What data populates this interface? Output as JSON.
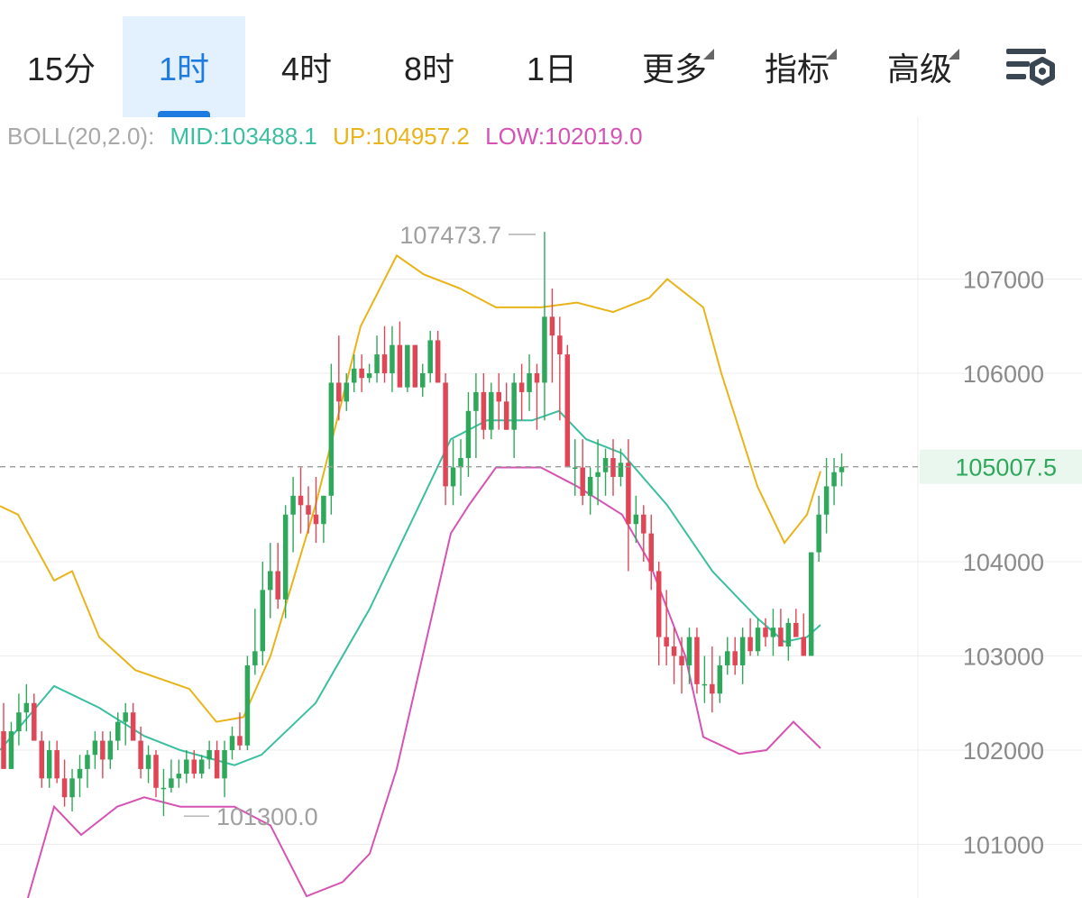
{
  "toolbar": {
    "tabs": [
      {
        "label": "15分",
        "active": false,
        "menu": false
      },
      {
        "label": "1时",
        "active": true,
        "menu": false
      },
      {
        "label": "4时",
        "active": false,
        "menu": false
      },
      {
        "label": "8时",
        "active": false,
        "menu": false
      },
      {
        "label": "1日",
        "active": false,
        "menu": false
      },
      {
        "label": "更多",
        "active": false,
        "menu": true
      },
      {
        "label": "指标",
        "active": false,
        "menu": true
      },
      {
        "label": "高级",
        "active": false,
        "menu": true
      }
    ],
    "settings_icon": "chart-settings-icon"
  },
  "boll": {
    "label": "BOLL(20,2.0):",
    "mid": "MID:103488.1",
    "up": "UP:104957.2",
    "low": "LOW:102019.0",
    "colors": {
      "label": "#a8a8a8",
      "mid": "#3bbfa0",
      "up": "#e8b419",
      "low": "#d653b4"
    }
  },
  "chart_data": {
    "type": "candlestick",
    "y_ticks": [
      "107000",
      "106000",
      "104000",
      "103000",
      "102000",
      "101000"
    ],
    "ylim": [
      100450,
      108300
    ],
    "current_price": "105007.5",
    "high_label": "107473.7",
    "low_label": "101300.0",
    "colors": {
      "up": "#2fa85c",
      "down": "#e04656",
      "mid": "#3bbfa0",
      "upper": "#e8b419",
      "lower": "#d653b4",
      "price": "#2fa85c"
    },
    "candles": [
      [
        102200,
        102500,
        101900,
        101800
      ],
      [
        101800,
        102300,
        101800,
        102200
      ],
      [
        102200,
        102600,
        102050,
        102400
      ],
      [
        102400,
        102700,
        102200,
        102500
      ],
      [
        102500,
        102600,
        102100,
        102100
      ],
      [
        102100,
        102200,
        101600,
        101700
      ],
      [
        101700,
        102100,
        101600,
        102000
      ],
      [
        102000,
        102100,
        101650,
        101700
      ],
      [
        101700,
        101900,
        101400,
        101500
      ],
      [
        101500,
        101800,
        101350,
        101700
      ],
      [
        101700,
        101950,
        101500,
        101800
      ],
      [
        101800,
        102000,
        101600,
        101950
      ],
      [
        101950,
        102200,
        101800,
        102100
      ],
      [
        102100,
        102200,
        101700,
        101900
      ],
      [
        101900,
        102200,
        101800,
        102100
      ],
      [
        102100,
        102400,
        102000,
        102300
      ],
      [
        102300,
        102500,
        102050,
        102400
      ],
      [
        102400,
        102500,
        102100,
        102100
      ],
      [
        102100,
        102250,
        101700,
        101800
      ],
      [
        101800,
        102050,
        101650,
        101950
      ],
      [
        101950,
        102000,
        101500,
        101600
      ],
      [
        101600,
        101800,
        101300,
        101600
      ],
      [
        101600,
        101900,
        101550,
        101700
      ],
      [
        101700,
        101900,
        101600,
        101750
      ],
      [
        101750,
        102000,
        101650,
        101900
      ],
      [
        101900,
        102000,
        101700,
        101750
      ],
      [
        101750,
        101950,
        101700,
        101900
      ],
      [
        101900,
        102100,
        101800,
        102000
      ],
      [
        102000,
        102100,
        101700,
        101700
      ],
      [
        101700,
        102100,
        101500,
        102000
      ],
      [
        102000,
        102250,
        101900,
        102150
      ],
      [
        102150,
        102400,
        102000,
        102050
      ],
      [
        102050,
        103000,
        102000,
        102900
      ],
      [
        102900,
        103500,
        102800,
        103050
      ],
      [
        103050,
        104000,
        102900,
        103700
      ],
      [
        103700,
        104200,
        103400,
        103900
      ],
      [
        103900,
        104200,
        103500,
        103600
      ],
      [
        103600,
        104600,
        103400,
        104500
      ],
      [
        104500,
        104900,
        104100,
        104700
      ],
      [
        104700,
        105000,
        104300,
        104600
      ],
      [
        104600,
        104800,
        104300,
        104500
      ],
      [
        104500,
        104900,
        104200,
        104400
      ],
      [
        104400,
        104700,
        104200,
        104700
      ],
      [
        104700,
        106100,
        104500,
        105900
      ],
      [
        105900,
        106400,
        105500,
        105700
      ],
      [
        105700,
        106000,
        105600,
        105900
      ],
      [
        105900,
        106200,
        105800,
        106050
      ],
      [
        106050,
        106200,
        105800,
        105950
      ],
      [
        105950,
        106100,
        105900,
        106000
      ],
      [
        106000,
        106400,
        105900,
        106200
      ],
      [
        106200,
        106500,
        105900,
        106000
      ],
      [
        106000,
        106500,
        105800,
        106300
      ],
      [
        106300,
        106550,
        105900,
        105850
      ],
      [
        105850,
        106300,
        105800,
        106300
      ],
      [
        106300,
        106300,
        105850,
        105850
      ],
      [
        105850,
        106100,
        105750,
        106000
      ],
      [
        106000,
        106450,
        105900,
        106350
      ],
      [
        106350,
        106450,
        105900,
        105900
      ],
      [
        105900,
        106000,
        104600,
        104800
      ],
      [
        104800,
        105300,
        104600,
        105000
      ],
      [
        105000,
        105300,
        104700,
        105100
      ],
      [
        105100,
        105800,
        104900,
        105600
      ],
      [
        105600,
        106000,
        105100,
        105800
      ],
      [
        105800,
        106000,
        105300,
        105400
      ],
      [
        105400,
        105900,
        105300,
        105800
      ],
      [
        105800,
        106000,
        105400,
        105700
      ],
      [
        105700,
        105900,
        105400,
        105400
      ],
      [
        105400,
        106000,
        105100,
        105900
      ],
      [
        105900,
        106100,
        105500,
        105800
      ],
      [
        105800,
        106200,
        105600,
        106000
      ],
      [
        106000,
        106100,
        105400,
        105900
      ],
      [
        105900,
        107500,
        105500,
        106600
      ],
      [
        106600,
        106900,
        105900,
        106400
      ],
      [
        106400,
        106600,
        105500,
        106200
      ],
      [
        106200,
        106300,
        105000,
        105000
      ],
      [
        105000,
        105300,
        104700,
        105000
      ],
      [
        105000,
        105300,
        104600,
        104700
      ],
      [
        104700,
        105000,
        104500,
        104900
      ],
      [
        104900,
        105300,
        104600,
        104950
      ],
      [
        104950,
        105200,
        104700,
        105100
      ],
      [
        105100,
        105300,
        104700,
        104900
      ],
      [
        104900,
        105200,
        104800,
        105050
      ],
      [
        105050,
        105300,
        103900,
        104400
      ],
      [
        104400,
        104700,
        104200,
        104500
      ],
      [
        104500,
        104600,
        104000,
        104300
      ],
      [
        104300,
        104500,
        103700,
        103900
      ],
      [
        103900,
        104000,
        102900,
        103200
      ],
      [
        103200,
        103700,
        102900,
        103100
      ],
      [
        103100,
        103300,
        102700,
        103000
      ],
      [
        103000,
        103200,
        102600,
        102900
      ],
      [
        102900,
        103300,
        102700,
        103200
      ],
      [
        103200,
        103300,
        102600,
        102700
      ],
      [
        102700,
        103000,
        102500,
        102700
      ],
      [
        102700,
        103100,
        102400,
        102600
      ],
      [
        102600,
        103000,
        102500,
        102900
      ],
      [
        102900,
        103200,
        102800,
        103050
      ],
      [
        103050,
        103200,
        102800,
        102900
      ],
      [
        102900,
        103300,
        102700,
        103200
      ],
      [
        103200,
        103400,
        103000,
        103050
      ],
      [
        103050,
        103400,
        103000,
        103300
      ],
      [
        103300,
        103400,
        103100,
        103200
      ],
      [
        103200,
        103500,
        103000,
        103300
      ],
      [
        103300,
        103500,
        103100,
        103100
      ],
      [
        103100,
        103400,
        102950,
        103350
      ],
      [
        103350,
        103500,
        103200,
        103200
      ],
      [
        103200,
        103450,
        103000,
        103000
      ],
      [
        103000,
        104100,
        103000,
        104100
      ],
      [
        104100,
        104700,
        104000,
        104500
      ],
      [
        104500,
        105100,
        104300,
        104800
      ],
      [
        104800,
        105100,
        104600,
        104950
      ],
      [
        104950,
        105150,
        104800,
        105007
      ]
    ],
    "mid_line": [
      [
        0,
        102000
      ],
      [
        60,
        102680
      ],
      [
        110,
        102450
      ],
      [
        160,
        102150
      ],
      [
        200,
        102000
      ],
      [
        260,
        101840
      ],
      [
        290,
        101950
      ],
      [
        350,
        102500
      ],
      [
        410,
        103500
      ],
      [
        470,
        104700
      ],
      [
        500,
        105300
      ],
      [
        540,
        105500
      ],
      [
        590,
        105500
      ],
      [
        620,
        105600
      ],
      [
        650,
        105300
      ],
      [
        690,
        105150
      ],
      [
        740,
        104600
      ],
      [
        790,
        103900
      ],
      [
        840,
        103400
      ],
      [
        870,
        103150
      ],
      [
        895,
        103200
      ],
      [
        910,
        103330
      ]
    ],
    "upper_line": [
      [
        0,
        104590
      ],
      [
        20,
        104500
      ],
      [
        60,
        103800
      ],
      [
        80,
        103900
      ],
      [
        110,
        103200
      ],
      [
        150,
        102850
      ],
      [
        210,
        102650
      ],
      [
        240,
        102300
      ],
      [
        270,
        102350
      ],
      [
        300,
        103000
      ],
      [
        350,
        104600
      ],
      [
        400,
        106500
      ],
      [
        440,
        107250
      ],
      [
        470,
        107050
      ],
      [
        510,
        106900
      ],
      [
        550,
        106700
      ],
      [
        600,
        106700
      ],
      [
        640,
        106750
      ],
      [
        680,
        106650
      ],
      [
        720,
        106800
      ],
      [
        740,
        107000
      ],
      [
        780,
        106700
      ],
      [
        800,
        106000
      ],
      [
        840,
        104800
      ],
      [
        870,
        104200
      ],
      [
        895,
        104500
      ],
      [
        910,
        104960
      ]
    ],
    "lower_line": [
      [
        30,
        100400
      ],
      [
        60,
        101400
      ],
      [
        90,
        101100
      ],
      [
        130,
        101400
      ],
      [
        160,
        101500
      ],
      [
        200,
        101400
      ],
      [
        260,
        101400
      ],
      [
        300,
        101200
      ],
      [
        340,
        100450
      ],
      [
        380,
        100600
      ],
      [
        410,
        100900
      ],
      [
        440,
        101800
      ],
      [
        500,
        104300
      ],
      [
        520,
        104600
      ],
      [
        550,
        105000
      ],
      [
        600,
        105000
      ],
      [
        640,
        104800
      ],
      [
        690,
        104500
      ],
      [
        720,
        104000
      ],
      [
        760,
        103000
      ],
      [
        780,
        102140
      ],
      [
        820,
        101960
      ],
      [
        850,
        102000
      ],
      [
        880,
        102300
      ],
      [
        910,
        102020
      ]
    ]
  }
}
